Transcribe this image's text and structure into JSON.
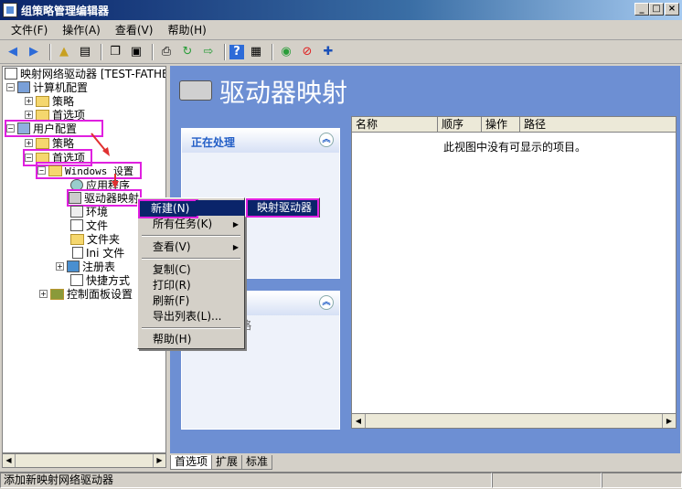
{
  "window": {
    "title": "组策略管理编辑器",
    "min": "_",
    "max": "□",
    "close": "×"
  },
  "menubar": [
    "文件(F)",
    "操作(A)",
    "查看(V)",
    "帮助(H)"
  ],
  "tree": {
    "root": "映射网络驱动器 [TEST-FATHERA",
    "computer_config": "计算机配置",
    "policy1": "策略",
    "prefs1": "首选项",
    "user_config": "用户配置",
    "policy2": "策略",
    "prefs2": "首选项",
    "windows_settings": "Windows 设置",
    "app": "应用程序",
    "drive_maps": "驱动器映射",
    "env": "环境",
    "files": "文件",
    "folders": "文件夹",
    "ini": "Ini 文件",
    "registry": "注册表",
    "shortcuts": "快捷方式",
    "control_panel": "控制面板设置"
  },
  "banner": {
    "title": "驱动器映射"
  },
  "panels": {
    "processing": "正在处理",
    "partial_text": "略"
  },
  "list": {
    "columns": [
      "名称",
      "顺序",
      "操作",
      "路径"
    ],
    "empty": "此视图中没有可显示的项目。"
  },
  "tabs": [
    "首选项",
    "扩展",
    "标准"
  ],
  "status": "添加新映射网络驱动器",
  "context_menu": {
    "new": "新建(N)",
    "all_tasks": "所有任务(K)",
    "view": "查看(V)",
    "copy": "复制(C)",
    "print": "打印(R)",
    "refresh": "刷新(F)",
    "export": "导出列表(L)...",
    "help": "帮助(H)"
  },
  "submenu": {
    "mapped_drive": "映射驱动器"
  },
  "accent_colors": {
    "highlight": "#e020e0",
    "arrow": "#e03030",
    "selection": "#0a246a"
  }
}
